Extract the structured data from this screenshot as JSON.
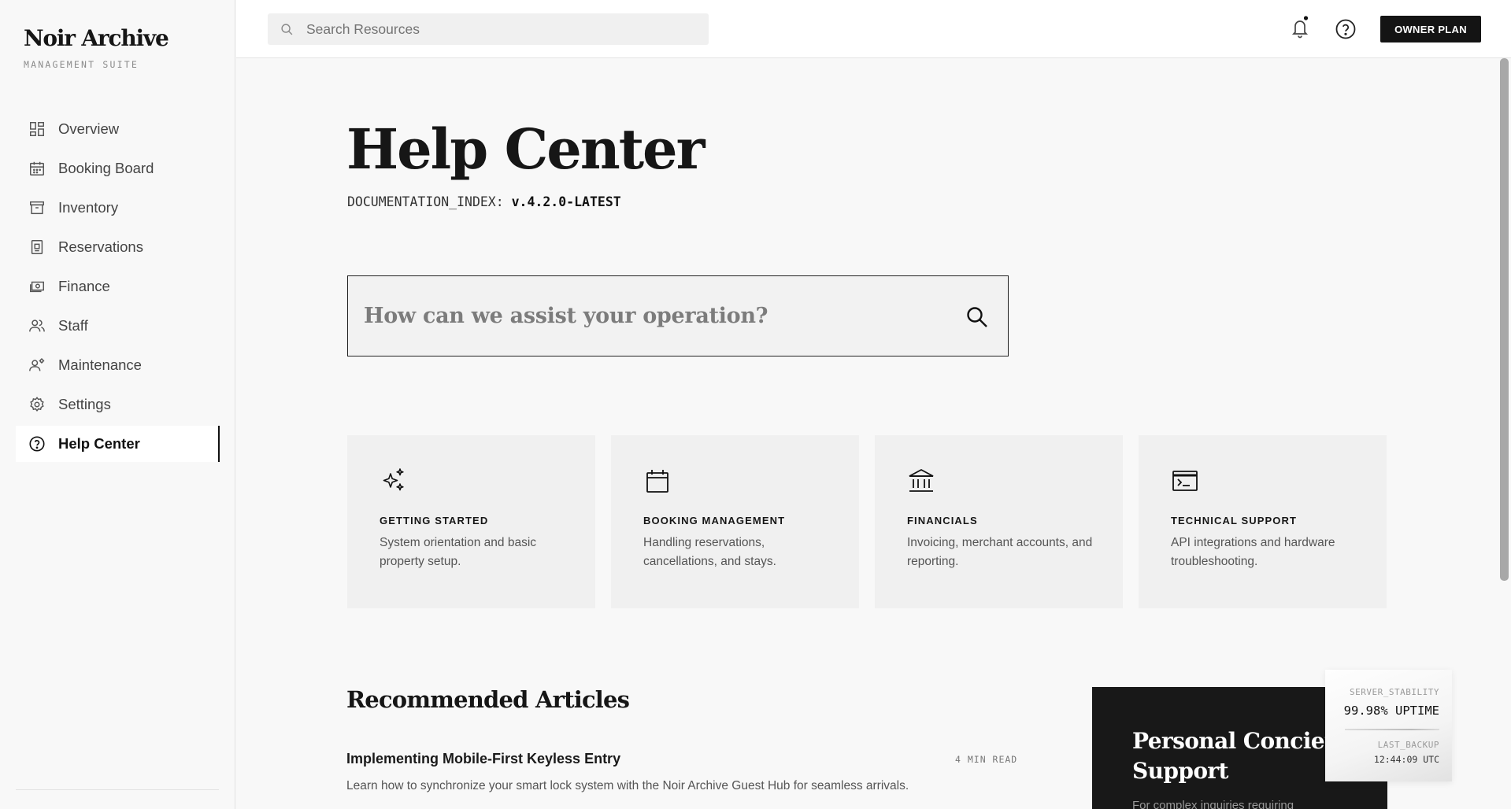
{
  "brand": {
    "name": "Noir Archive",
    "subtitle": "MANAGEMENT SUITE"
  },
  "sidebar": {
    "items": [
      {
        "label": "Overview",
        "icon": "grid-icon",
        "active": false
      },
      {
        "label": "Booking Board",
        "icon": "calendar-icon",
        "active": false
      },
      {
        "label": "Inventory",
        "icon": "archive-box-icon",
        "active": false
      },
      {
        "label": "Reservations",
        "icon": "document-icon",
        "active": false
      },
      {
        "label": "Finance",
        "icon": "cash-icon",
        "active": false
      },
      {
        "label": "Staff",
        "icon": "people-icon",
        "active": false
      },
      {
        "label": "Maintenance",
        "icon": "engineer-icon",
        "active": false
      },
      {
        "label": "Settings",
        "icon": "gear-icon",
        "active": false
      },
      {
        "label": "Help Center",
        "icon": "help-circle-icon",
        "active": true
      }
    ]
  },
  "topbar": {
    "search_placeholder": "Search Resources",
    "plan_label": "OWNER PLAN"
  },
  "main": {
    "title": "Help Center",
    "doc_index_key": "DOCUMENTATION_INDEX:",
    "doc_index_value": "v.4.2.0-LATEST",
    "search_prompt": "How can we assist your operation?",
    "categories": [
      {
        "title": "GETTING STARTED",
        "desc": "System orientation and basic property setup.",
        "icon": "sparkles-icon"
      },
      {
        "title": "BOOKING MANAGEMENT",
        "desc": "Handling reservations, cancellations, and stays.",
        "icon": "calendar-icon"
      },
      {
        "title": "FINANCIALS",
        "desc": "Invoicing, merchant accounts, and reporting.",
        "icon": "bank-icon"
      },
      {
        "title": "TECHNICAL SUPPORT",
        "desc": "API integrations and hardware troubleshooting.",
        "icon": "terminal-icon"
      }
    ],
    "recommended_title": "Recommended Articles",
    "articles": [
      {
        "title": "Implementing Mobile-First Keyless Entry",
        "read_time": "4 MIN READ",
        "desc": "Learn how to synchronize your smart lock system with the Noir Archive Guest Hub for seamless arrivals."
      }
    ],
    "concierge": {
      "title_line1": "Personal Concierge",
      "title_line2": "Support",
      "desc": "For complex inquiries requiring"
    }
  },
  "status": {
    "stability_key": "SERVER_STABILITY",
    "stability_value": "99.98% UPTIME",
    "backup_key": "LAST_BACKUP",
    "backup_value": "12:44:09 UTC"
  }
}
